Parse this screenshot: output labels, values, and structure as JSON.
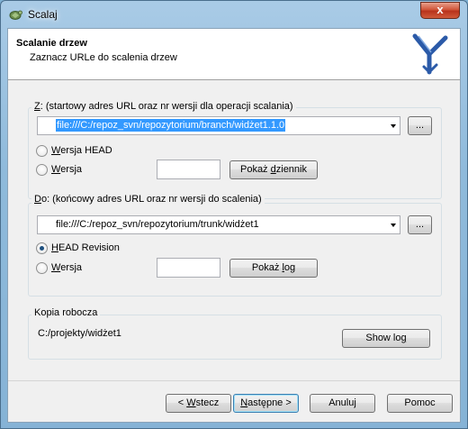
{
  "window": {
    "title": "Scalaj",
    "close_label": "x"
  },
  "header": {
    "title": "Scalanie drzew",
    "subtitle": "Zaznacz URLe do scalenia drzew"
  },
  "from_group": {
    "label_key": "Z",
    "label_rest": ": (startowy adres URL oraz nr wersji dla operacji scalania)",
    "url": "file:///C:/repoz_svn/repozytorium/branch/widżet1.1.0",
    "browse_label": "...",
    "radio_head_key": "W",
    "radio_head_rest": "ersja HEAD",
    "radio_rev_key": "W",
    "radio_rev_rest": "ersja",
    "revision_value": "",
    "log_label_pre": "Pokaż ",
    "log_label_key": "d",
    "log_label_post": "ziennik",
    "selected_radio": "head"
  },
  "to_group": {
    "label_key": "D",
    "label_rest": "o: (końcowy adres URL oraz nr wersji do scalenia)",
    "url": "file:///C:/repoz_svn/repozytorium/trunk/widżet1",
    "browse_label": "...",
    "radio_head_key": "H",
    "radio_head_rest": "EAD Revision",
    "radio_rev_key": "W",
    "radio_rev_rest": "ersja",
    "revision_value": "",
    "log_label_pre": "Pokaż ",
    "log_label_key": "l",
    "log_label_post": "og",
    "selected_radio": "head"
  },
  "working_copy": {
    "label": "Kopia robocza",
    "path": "C:/projekty/widżet1",
    "log_label_pre": "Show lo",
    "log_label_key": "g",
    "log_label_post": ""
  },
  "footer": {
    "back_pre": "< ",
    "back_key": "W",
    "back_post": "stecz",
    "next_pre": "",
    "next_key": "N",
    "next_post": "astępne >",
    "cancel_label": "Anuluj",
    "help_label": "Pomoc"
  },
  "colors": {
    "selection": "#3399ff",
    "header_bg": "#ffffff",
    "dialog_bg": "#f0f0f0",
    "title_gradient_top": "#a9cbe6",
    "close_button": "#c7462a"
  }
}
